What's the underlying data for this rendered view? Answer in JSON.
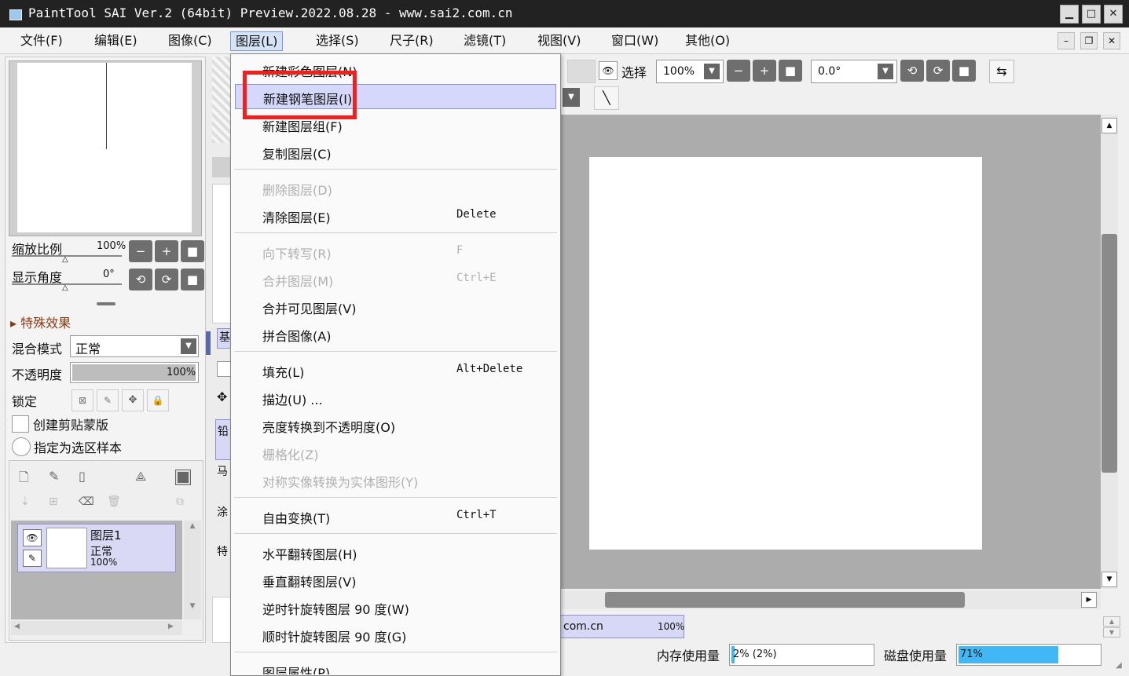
{
  "titlebar": {
    "title": "PaintTool SAI Ver.2 (64bit) Preview.2022.08.28 - www.sai2.com.cn",
    "minimize": "▁",
    "maximize": "□",
    "close": "✕"
  },
  "menubar": {
    "items": [
      "文件(F)",
      "编辑(E)",
      "图像(C)",
      "图层(L)",
      "选择(S)",
      "尺子(R)",
      "滤镜(T)",
      "视图(V)",
      "窗口(W)",
      "其他(O)"
    ],
    "active_index": 3
  },
  "left_panel": {
    "zoom_label": "缩放比例",
    "zoom_value": "100%",
    "angle_label": "显示角度",
    "angle_value": "0°",
    "effects_label": "特殊效果",
    "blend_label": "混合模式",
    "blend_value": "正常",
    "opacity_label": "不透明度",
    "opacity_value": "100%",
    "lock_label": "锁定",
    "clip_label": "创建剪贴蒙版",
    "sample_label": "指定为选区样本",
    "layer": {
      "name": "图层1",
      "mode": "正常",
      "opacity": "100%"
    }
  },
  "middle_strip": {
    "tabs": [
      "基"
    ],
    "items": [
      "铅",
      "马",
      "涂",
      "特"
    ]
  },
  "toolbar": {
    "selection_label": "选择",
    "zoom": "100%",
    "angle": "0.0°"
  },
  "status": {
    "doc_name": "com.cn",
    "doc_zoom": "100%",
    "memory_label": "内存使用量",
    "memory_value": "2% (2%)",
    "memory_fraction": 0.02,
    "disk_label": "磁盘使用量",
    "disk_value": "71%",
    "disk_fraction": 0.71
  },
  "layer_menu": {
    "items": [
      {
        "label": "新建彩色图层(N)",
        "shortcut": "",
        "disabled": false
      },
      {
        "label": "新建钢笔图层(I)",
        "shortcut": "",
        "disabled": false,
        "highlighted": true
      },
      {
        "label": "新建图层组(F)",
        "shortcut": "",
        "disabled": false
      },
      {
        "label": "复制图层(C)",
        "shortcut": "",
        "disabled": false
      },
      {
        "label": "删除图层(D)",
        "shortcut": "",
        "disabled": true
      },
      {
        "label": "清除图层(E)",
        "shortcut": "Delete",
        "disabled": false
      },
      {
        "label": "向下转写(R)",
        "shortcut": "F",
        "disabled": true
      },
      {
        "label": "合并图层(M)",
        "shortcut": "Ctrl+E",
        "disabled": true
      },
      {
        "label": "合并可见图层(V)",
        "shortcut": "",
        "disabled": false
      },
      {
        "label": "拼合图像(A)",
        "shortcut": "",
        "disabled": false
      },
      {
        "label": "填充(L)",
        "shortcut": "Alt+Delete",
        "disabled": false
      },
      {
        "label": "描边(U) ...",
        "shortcut": "",
        "disabled": false
      },
      {
        "label": "亮度转换到不透明度(O)",
        "shortcut": "",
        "disabled": false
      },
      {
        "label": "栅格化(Z)",
        "shortcut": "",
        "disabled": true
      },
      {
        "label": "对称实像转换为实体图形(Y)",
        "shortcut": "",
        "disabled": true
      },
      {
        "label": "自由变换(T)",
        "shortcut": "Ctrl+T",
        "disabled": false
      },
      {
        "label": "水平翻转图层(H)",
        "shortcut": "",
        "disabled": false
      },
      {
        "label": "垂直翻转图层(V)",
        "shortcut": "",
        "disabled": false
      },
      {
        "label": "逆时针旋转图层 90 度(W)",
        "shortcut": "",
        "disabled": false
      },
      {
        "label": "顺时针旋转图层 90 度(G)",
        "shortcut": "",
        "disabled": false
      },
      {
        "label": "图层属性(P) ...",
        "shortcut": "",
        "disabled": false
      }
    ]
  }
}
